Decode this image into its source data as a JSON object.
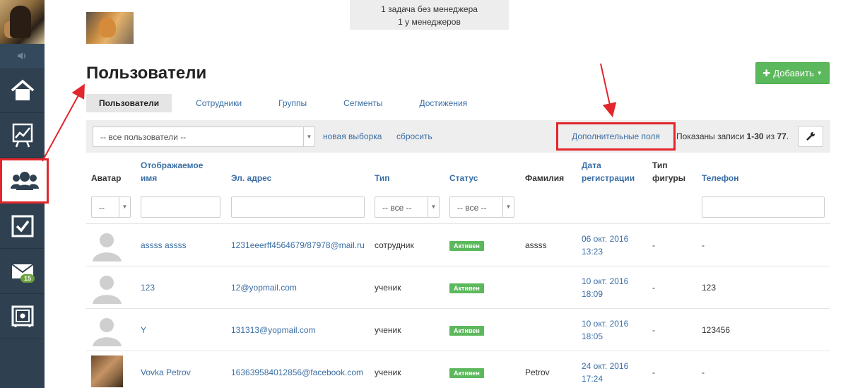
{
  "notice": {
    "line1": "1 задача без менеджера",
    "line2": "1 у менеджеров"
  },
  "sidebar": {
    "mail_badge": "15"
  },
  "page": {
    "title": "Пользователи",
    "add_button": "Добавить"
  },
  "tabs": [
    {
      "label": "Пользователи",
      "active": true
    },
    {
      "label": "Сотрудники"
    },
    {
      "label": "Группы"
    },
    {
      "label": "Сегменты"
    },
    {
      "label": "Достижения"
    }
  ],
  "filterbar": {
    "segment_value": "-- все пользователи --",
    "new_selection": "новая выборка",
    "reset": "сбросить",
    "extra_fields": "Дополнительные поля",
    "shown_prefix": "Показаны записи ",
    "shown_range": "1-30",
    "shown_of": " из ",
    "shown_total": "77",
    "shown_suffix": "."
  },
  "columns": {
    "avatar": "Аватар",
    "display_name_1": "Отображаемое",
    "display_name_2": "имя",
    "email": "Эл. адрес",
    "type": "Тип",
    "status": "Статус",
    "lastname": "Фамилия",
    "reg_date_1": "Дата",
    "reg_date_2": "регистрации",
    "figure_type_1": "Тип",
    "figure_type_2": "фигуры",
    "phone": "Телефон"
  },
  "filters": {
    "avatar_value": "--",
    "type_value": "-- все --",
    "status_value": "-- все --"
  },
  "rows": [
    {
      "name": "assss assss",
      "email": "1231eeerff4564679/87978@mail.ru",
      "type": "сотрудник",
      "status": "Активен",
      "lastname": "assss",
      "date": "06 окт. 2016",
      "time": "13:23",
      "figure": "-",
      "phone": "-"
    },
    {
      "name": "123",
      "email": "12@yopmail.com",
      "type": "ученик",
      "status": "Активен",
      "lastname": "",
      "date": "10 окт. 2016",
      "time": "18:09",
      "figure": "-",
      "phone": "123"
    },
    {
      "name": "Y",
      "email": "131313@yopmail.com",
      "type": "ученик",
      "status": "Активен",
      "lastname": "",
      "date": "10 окт. 2016",
      "time": "18:05",
      "figure": "-",
      "phone": "123456"
    },
    {
      "name": "Vovka Petrov",
      "email": "163639584012856@facebook.com",
      "type": "ученик",
      "status": "Активен",
      "lastname": "Petrov",
      "date": "24 окт. 2016",
      "time": "17:24",
      "figure": "-",
      "phone": "-"
    }
  ]
}
